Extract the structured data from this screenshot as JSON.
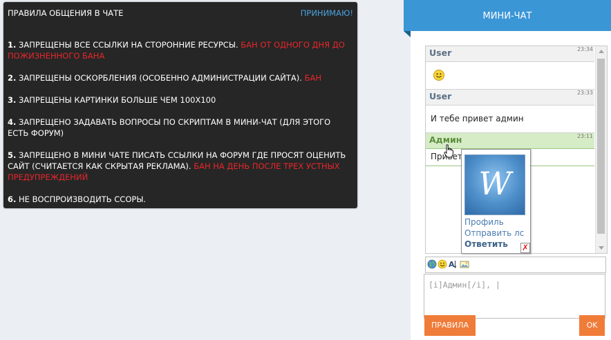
{
  "rules": {
    "title": "ПРАВИЛА ОБЩЕНИЯ В ЧАТЕ",
    "accept_label": "ПРИНИМАЮ!",
    "items": [
      {
        "num": "1.",
        "text": "ЗАПРЕЩЕНЫ ВСЕ ССЫЛКИ НА СТОРОННИЕ РЕСУРСЫ.",
        "penalty": "БАН ОТ ОДНОГО ДНЯ ДО ПОЖИЗНЕННОГО БАНА"
      },
      {
        "num": "2.",
        "text": "ЗАПРЕЩЕНЫ ОСКОРБЛЕНИЯ (ОСОБЕННО АДМИНИСТРАЦИИ САЙТА).",
        "penalty": "БАН"
      },
      {
        "num": "3.",
        "text": "ЗАПРЕЩЕНЫ КАРТИНКИ БОЛЬШЕ ЧЕМ 100Х100",
        "penalty": ""
      },
      {
        "num": "4.",
        "text": "ЗАПРЕЩЕНО ЗАДАВАТЬ ВОПРОСЫ ПО СКРИПТАМ В МИНИ-ЧАТ (ДЛЯ ЭТОГО ЕСТЬ ФОРУМ)",
        "penalty": ""
      },
      {
        "num": "5.",
        "text": "ЗАПРЕЩЕНО В МИНИ ЧАТЕ ПИСАТЬ ССЫЛКИ НА ФОРУМ ГДЕ ПРОСЯТ ОЦЕНИТЬ САЙТ (СЧИТАЕТСЯ КАК СКРЫТАЯ РЕКЛАМА).",
        "penalty": "БАН НА ДЕНЬ ПОСЛЕ ТРЕХ УСТНЫХ ПРЕДУПРЕЖДЕНИЙ"
      },
      {
        "num": "6.",
        "text": "НЕ ВОСПРОИЗВОДИТЬ ССОРЫ.",
        "penalty": ""
      }
    ]
  },
  "chat": {
    "header": "МИНИ-ЧАТ",
    "messages": [
      {
        "user": "User",
        "time": "23:34",
        "text": "",
        "icon": "smiley-icon"
      },
      {
        "user": "User",
        "time": "23:33",
        "text": "И тебе привет админ"
      },
      {
        "user": "Админ",
        "time": "23:11",
        "text": "Привет"
      }
    ],
    "popup": {
      "avatar_letter": "W",
      "profile_label": "Профиль",
      "pm_label": "Отправить лс",
      "reply_label": "Ответить",
      "close_label": "✗"
    },
    "toolbar_icons": [
      "globe-icon",
      "smiley-icon",
      "text-format-icon",
      "image-icon"
    ],
    "input_value": "[i]Админ[/i], |",
    "rules_button": "ПРАВИЛА",
    "ok_button": "OK"
  },
  "colors": {
    "rules_bg": "#262626",
    "accent_blue": "#3b96d6",
    "penalty_red": "#e8262b",
    "button_orange": "#f07c39",
    "admin_green": "#d5ecc7"
  }
}
